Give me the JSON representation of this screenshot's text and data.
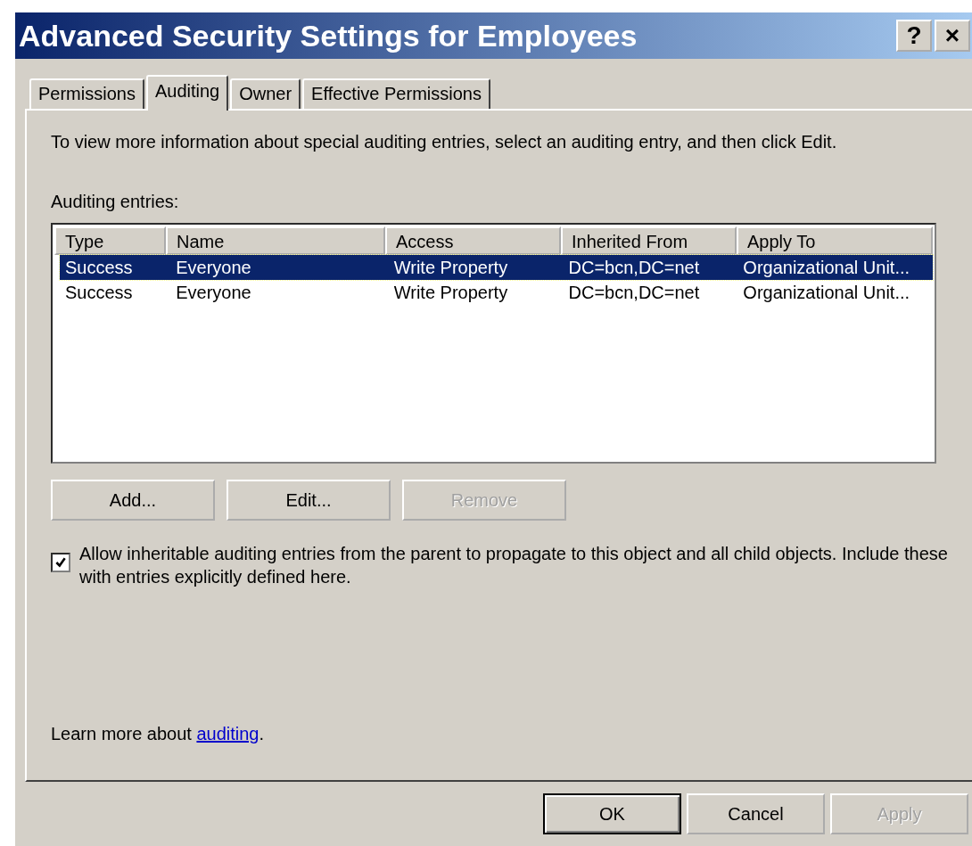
{
  "window": {
    "title": "Advanced Security Settings for Employees",
    "title_buttons": [
      "?",
      "×"
    ]
  },
  "tabs": [
    {
      "label": "Permissions",
      "selected": false
    },
    {
      "label": "Auditing",
      "selected": true
    },
    {
      "label": "Owner",
      "selected": false
    },
    {
      "label": "Effective Permissions",
      "selected": false
    }
  ],
  "intro": "To view more information about special auditing entries, select an auditing entry, and then click Edit.",
  "entries_label": "Auditing entries:",
  "table": {
    "columns": [
      "Type",
      "Name",
      "Access",
      "Inherited From",
      "Apply To"
    ],
    "rows": [
      {
        "cells": [
          "Success",
          "Everyone",
          "Write Property",
          "DC=bcn,DC=net",
          "Organizational Unit..."
        ],
        "selected": true
      },
      {
        "cells": [
          "Success",
          "Everyone",
          "Write Property",
          "DC=bcn,DC=net",
          "Organizational Unit..."
        ],
        "selected": false
      }
    ]
  },
  "list_buttons": [
    {
      "label": "Add...",
      "disabled": false
    },
    {
      "label": "Edit...",
      "disabled": false
    },
    {
      "label": "Remove",
      "disabled": true
    }
  ],
  "inherit_checkbox": {
    "label": "Allow inheritable auditing entries from the parent to propagate to this object and all child objects. Include these with entries explicitly defined here.",
    "checked": true
  },
  "learn_more": {
    "text": "Learn more about",
    "link": "auditing",
    "after": "."
  },
  "dialog_buttons": [
    {
      "label": "OK",
      "default": true,
      "disabled": false
    },
    {
      "label": "Cancel",
      "default": false,
      "disabled": false
    },
    {
      "label": "Apply",
      "default": false,
      "disabled": true
    }
  ]
}
